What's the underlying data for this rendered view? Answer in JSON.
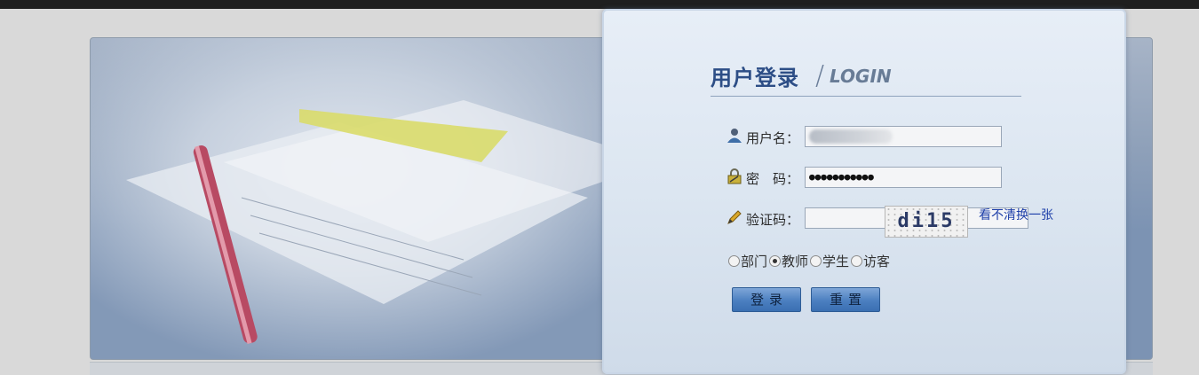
{
  "login": {
    "title_cn": "用户登录",
    "separator": "/",
    "title_en": "LOGIN",
    "username_label": "用户名：",
    "username_value": "",
    "password_label": "密　码：",
    "password_value": "●●●●●●●●●●●",
    "captcha_label": "验证码：",
    "captcha_value": "",
    "captcha_image_text": "di15",
    "refresh_captcha": "看不清换一张",
    "roles": [
      {
        "label": "部门",
        "checked": false
      },
      {
        "label": "教师",
        "checked": true
      },
      {
        "label": "学生",
        "checked": false
      },
      {
        "label": "访客",
        "checked": false
      }
    ],
    "login_button": "登录",
    "reset_button": "重置"
  },
  "icons": {
    "username": "user-icon",
    "password": "lock-icon",
    "captcha": "pencil-icon"
  }
}
